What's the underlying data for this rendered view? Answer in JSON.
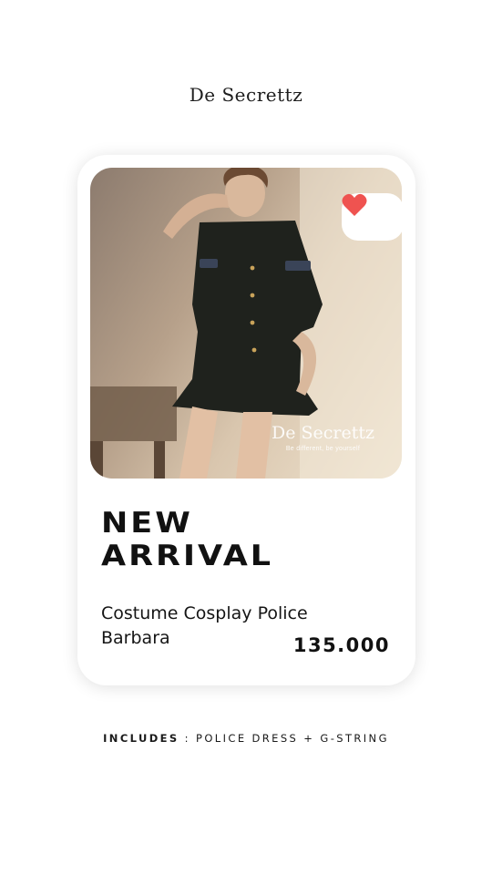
{
  "brand": {
    "name": "De Secrettz"
  },
  "card": {
    "watermark": {
      "brand": "De Secrettz",
      "tagline": "Be different, be yourself"
    },
    "favorite": {
      "icon": "heart-icon",
      "color": "#ef5350",
      "selected": true
    },
    "headline": {
      "line1": "NEW",
      "line2": "ARRIVAL"
    },
    "product": {
      "name_line1": "Costume Cosplay Police",
      "name_line2": "Barbara",
      "price": "135.000"
    }
  },
  "footer": {
    "includes_label": "INCLUDES",
    "separator": ":",
    "includes_text": "POLICE DRESS + G-STRING"
  }
}
